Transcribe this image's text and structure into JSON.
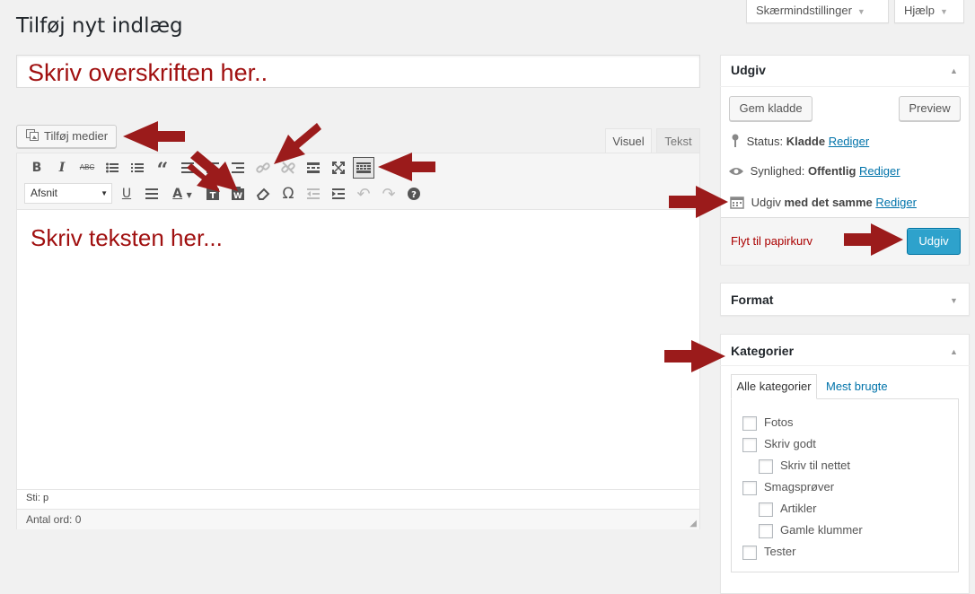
{
  "header": {
    "page_title": "Tilføj nyt indlæg",
    "screen_options_label": "Skærmindstillinger",
    "help_label": "Hjælp"
  },
  "title_field": {
    "placeholder": "Skriv overskriften her.."
  },
  "media": {
    "add_media_label": "Tilføj medier"
  },
  "editor": {
    "tab_visual": "Visuel",
    "tab_text": "Tekst",
    "format_select_value": "Afsnit",
    "content_placeholder": "Skriv teksten her...",
    "path_label": "Sti: p",
    "word_count_label": "Antal ord: 0",
    "toolbar_icons": [
      "bold-icon",
      "italic-icon",
      "strikethrough-icon",
      "bullet-list-icon",
      "numbered-list-icon",
      "blockquote-icon",
      "align-left-icon",
      "align-center-icon",
      "align-right-icon",
      "insert-link-icon",
      "remove-link-icon",
      "read-more-icon",
      "fullscreen-icon",
      "toolbar-toggle-icon",
      "underline-icon",
      "justify-icon",
      "text-color-icon",
      "paste-as-text-icon",
      "paste-from-word-icon",
      "clear-formatting-icon",
      "special-character-icon",
      "outdent-icon",
      "indent-icon",
      "undo-icon",
      "redo-icon",
      "help-icon"
    ]
  },
  "publish_box": {
    "heading": "Udgiv",
    "save_draft_label": "Gem kladde",
    "preview_label": "Preview",
    "status_label": "Status:",
    "status_value": "Kladde",
    "visibility_label": "Synlighed:",
    "visibility_value": "Offentlig",
    "publish_label": "Udgiv",
    "publish_value": "med det samme",
    "edit_link": "Rediger",
    "trash_label": "Flyt til papirkurv",
    "publish_button": "Udgiv"
  },
  "format_box": {
    "heading": "Format"
  },
  "categories_box": {
    "heading": "Kategorier",
    "tab_all": "Alle kategorier",
    "tab_popular": "Mest brugte",
    "items": [
      {
        "label": "Fotos",
        "level": 0
      },
      {
        "label": "Skriv godt",
        "level": 0
      },
      {
        "label": "Skriv til nettet",
        "level": 1
      },
      {
        "label": "Smagsprøver",
        "level": 0
      },
      {
        "label": "Artikler",
        "level": 1
      },
      {
        "label": "Gamle klummer",
        "level": 1
      },
      {
        "label": "Tester",
        "level": 0
      }
    ]
  },
  "colors": {
    "background": "#f1f1f1",
    "annotation_red": "#a01010",
    "arrow_red": "#9b1b1b",
    "link_blue": "#0073aa",
    "primary_button": "#2ea2cc",
    "trash_red": "#a00"
  }
}
